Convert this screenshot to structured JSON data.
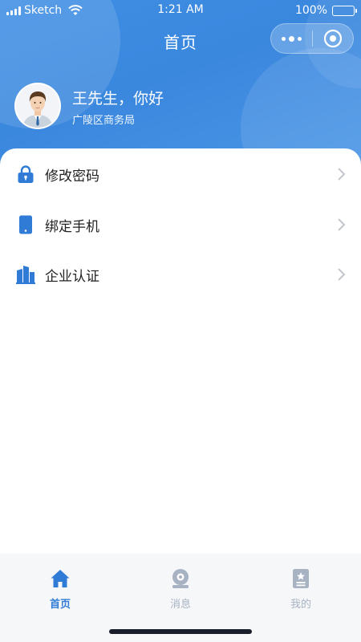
{
  "status_bar": {
    "carrier": "Sketch",
    "time": "1:21 AM",
    "battery": "100%",
    "battery_level": 1.0
  },
  "nav": {
    "title": "首页",
    "capsule_icons": [
      "more-dots-icon",
      "close-target-icon"
    ]
  },
  "profile": {
    "greeting": "王先生，你好",
    "organization": "广陵区商务局",
    "avatar_icon": "user-avatar-icon"
  },
  "menu": {
    "items": [
      {
        "label": "修改密码",
        "icon": "lock-icon"
      },
      {
        "label": "绑定手机",
        "icon": "phone-icon"
      },
      {
        "label": "企业认证",
        "icon": "building-icon"
      }
    ]
  },
  "tabbar": {
    "tabs": [
      {
        "label": "首页",
        "icon": "home-icon",
        "active": true
      },
      {
        "label": "消息",
        "icon": "message-icon",
        "active": false
      },
      {
        "label": "我的",
        "icon": "profile-card-icon",
        "active": false
      }
    ]
  },
  "colors": {
    "brand_blue": "#3a87de",
    "active_tab": "#2f7bd6",
    "inactive_tab": "#a7b2c3",
    "icon_blue": "#2f7bd6"
  }
}
